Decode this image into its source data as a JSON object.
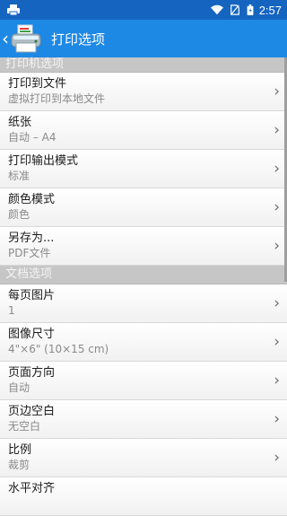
{
  "status_bar": {
    "time": "2:57",
    "icons": [
      "printer-notification-icon",
      "wifi-icon",
      "no-sim-icon",
      "battery-icon"
    ]
  },
  "app_bar": {
    "title": "打印选项",
    "back_icon": "chevron-left-icon",
    "app_icon": "printer-icon"
  },
  "sections": {
    "printer": "打印机选项",
    "document": "文档选项"
  },
  "printer_options": [
    {
      "title": "打印到文件",
      "value": "虚拟打印到本地文件"
    },
    {
      "title": "纸张",
      "value": "自动 – A4"
    },
    {
      "title": "打印输出模式",
      "value": "标准"
    },
    {
      "title": "颜色模式",
      "value": "颜色"
    },
    {
      "title": "另存为...",
      "value": "PDF文件"
    }
  ],
  "document_options": [
    {
      "title": "每页图片",
      "value": "1"
    },
    {
      "title": "图像尺寸",
      "value": "4\"×6\" (10×15 cm)"
    },
    {
      "title": "页面方向",
      "value": "自动"
    },
    {
      "title": "页边空白",
      "value": "无空白"
    },
    {
      "title": "比例",
      "value": "裁剪"
    },
    {
      "title": "水平对齐",
      "value": ""
    }
  ],
  "chevron": "›",
  "colors": {
    "status_bar": "#1565c0",
    "app_bar": "#1e88e5",
    "section_header": "#c6c6c6"
  }
}
